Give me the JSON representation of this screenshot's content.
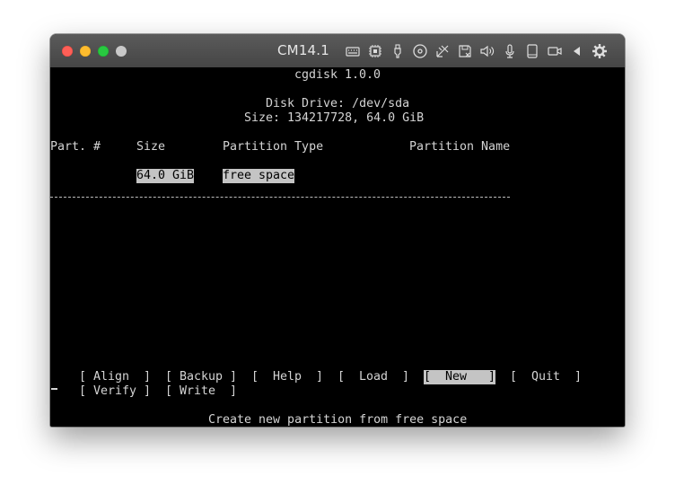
{
  "window": {
    "title": "CM14.1",
    "toolbar_icons": [
      "keyboard-icon",
      "cpu-icon",
      "usb-icon",
      "cd-icon",
      "network-icon",
      "save-icon",
      "volume-icon",
      "microphone-icon",
      "tablet-icon",
      "camera-icon",
      "back-icon",
      "settings-icon"
    ]
  },
  "app": {
    "title": "cgdisk 1.0.0",
    "disk_line": "Disk Drive: /dev/sda",
    "size_line": "Size: 134217728, 64.0 GiB"
  },
  "table": {
    "headers": {
      "part_no": "Part. #",
      "size": "Size",
      "type": "Partition Type",
      "name": "Partition Name"
    },
    "rows": [
      {
        "part_no": "",
        "size": "64.0 GiB",
        "type": "free space",
        "name": ""
      }
    ]
  },
  "menu": {
    "items": [
      {
        "label": "[ Align  ]",
        "selected": false
      },
      {
        "label": "[ Backup ]",
        "selected": false
      },
      {
        "label": "[  Help  ]",
        "selected": false
      },
      {
        "label": "[  Load  ]",
        "selected": false
      },
      {
        "label": "[  New   ]",
        "selected": true
      },
      {
        "label": "[  Quit  ]",
        "selected": false
      },
      {
        "label": "[ Verify ]",
        "selected": false
      },
      {
        "label": "[ Write  ]",
        "selected": false
      }
    ],
    "status": "Create new partition from free space"
  },
  "colors": {
    "terminal_bg": "#000000",
    "terminal_fg": "#d4d4d4",
    "highlight_bg": "#c4c4c4"
  }
}
